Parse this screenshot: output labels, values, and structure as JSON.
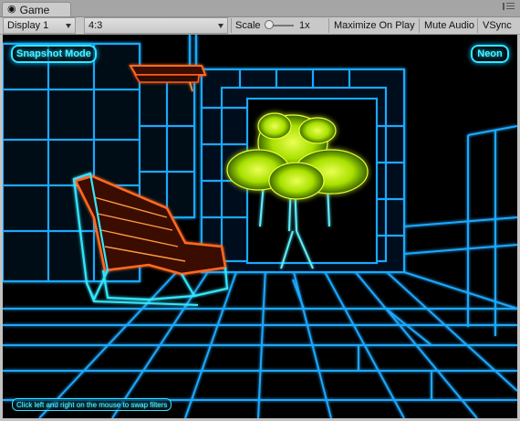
{
  "window": {
    "tab_glyph": "◉",
    "tab_title": "Game",
    "menu_icon": "kebab-menu-icon"
  },
  "toolbar": {
    "display_select": "Display 1",
    "aspect_select": "4:3",
    "scale_label": "Scale",
    "scale_value": "1x",
    "maximize_label": "Maximize On Play",
    "mute_label": "Mute Audio",
    "vsync_label": "VSync"
  },
  "game": {
    "snapshot_mode": "Snapshot Mode",
    "filter_name": "Neon",
    "hint": "Click left and right on the mouse to swap filters"
  },
  "colors": {
    "neon_cyan": "#1ea8ff",
    "neon_bright": "#5ff0ff",
    "bench": "#ff5a1a",
    "tree": "#ccff00"
  }
}
